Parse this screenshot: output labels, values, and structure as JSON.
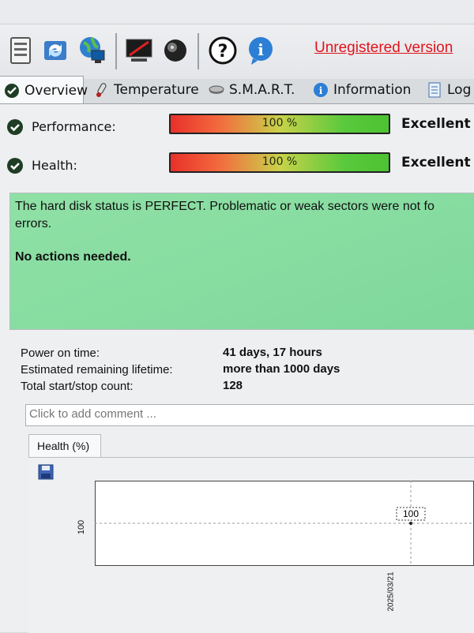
{
  "toolbar": {
    "icons": [
      "clipboard-icon",
      "refresh-icon",
      "network-computer-icon",
      "monitor-icon",
      "speaker-icon",
      "help-icon",
      "info-icon"
    ],
    "unregistered_label": "Unregistered version"
  },
  "tabs": [
    {
      "label": "Overview",
      "icon": "check-icon",
      "active": true
    },
    {
      "label": "Temperature",
      "icon": "thermometer-icon"
    },
    {
      "label": "S.M.A.R.T.",
      "icon": "disk-icon"
    },
    {
      "label": "Information",
      "icon": "info-icon"
    },
    {
      "label": "Log",
      "icon": "document-icon"
    }
  ],
  "metrics": [
    {
      "label": "Performance:",
      "value": "100 %",
      "percent": 100,
      "rating": "Excellent"
    },
    {
      "label": "Health:",
      "value": "100 %",
      "percent": 100,
      "rating": "Excellent"
    }
  ],
  "status": {
    "line1": "The hard disk status is PERFECT. Problematic or weak sectors were not fo",
    "line2": "errors.",
    "action": "No actions needed.",
    "color": "#86dca0"
  },
  "info": {
    "power_on_label": "Power on time:",
    "power_on_value": "41 days, 17 hours",
    "lifetime_label": "Estimated remaining lifetime:",
    "lifetime_value": "more than 1000 days",
    "startstop_label": "Total start/stop count:",
    "startstop_value": "128"
  },
  "comment": {
    "placeholder": "Click to add comment ..."
  },
  "chart_tab": {
    "label": "Health (%)"
  },
  "chart_data": {
    "type": "line",
    "x": [
      "2025/03/21"
    ],
    "values": [
      100
    ],
    "yticks": [
      "100"
    ],
    "point_label": "100",
    "grid": true
  },
  "colors": {
    "accent_red": "#e0141d",
    "check_green": "#1e5e2a",
    "bar_green": "#4dc233",
    "bar_red": "#e8302a"
  }
}
